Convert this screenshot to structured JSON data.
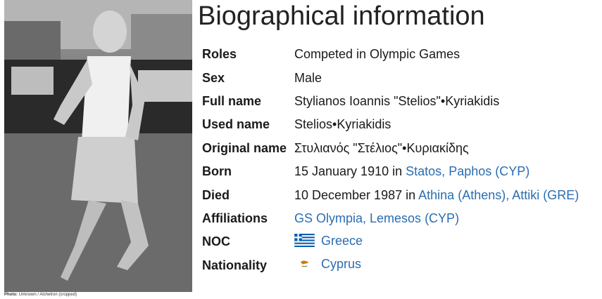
{
  "page": {
    "title": "Biographical information",
    "photo_credit_label": "Photo:",
    "photo_credit": "Unknown / Alchetron (cropped)"
  },
  "rows": [
    {
      "key": "Roles",
      "value": "Competed in Olympic Games"
    },
    {
      "key": "Sex",
      "value": "Male"
    },
    {
      "key": "Full name",
      "value": "Stylianos Ioannis \"Stelios\"•Kyriakidis"
    },
    {
      "key": "Used name",
      "value": "Stelios•Kyriakidis"
    },
    {
      "key": "Original name",
      "value": "Στυλιανός \"Στέλιος\"•Κυριακίδης"
    },
    {
      "key": "Born",
      "date": "15 January 1910",
      "in": "in",
      "place": "Statos, Paphos (CYP)"
    },
    {
      "key": "Died",
      "date": "10 December 1987",
      "in": "in",
      "place": "Athina (Athens), Attiki (GRE)"
    },
    {
      "key": "Affiliations",
      "link": "GS Olympia, Lemesos (CYP)"
    },
    {
      "key": "NOC",
      "link": "Greece",
      "icon": "greece-flag-icon"
    },
    {
      "key": "Nationality",
      "link": "Cyprus",
      "icon": "cyprus-flag-icon"
    }
  ],
  "colors": {
    "link": "#2a6db0",
    "text": "#1a1a1a",
    "greece_blue": "#0d5eaf",
    "cyprus_copper": "#d57800"
  }
}
